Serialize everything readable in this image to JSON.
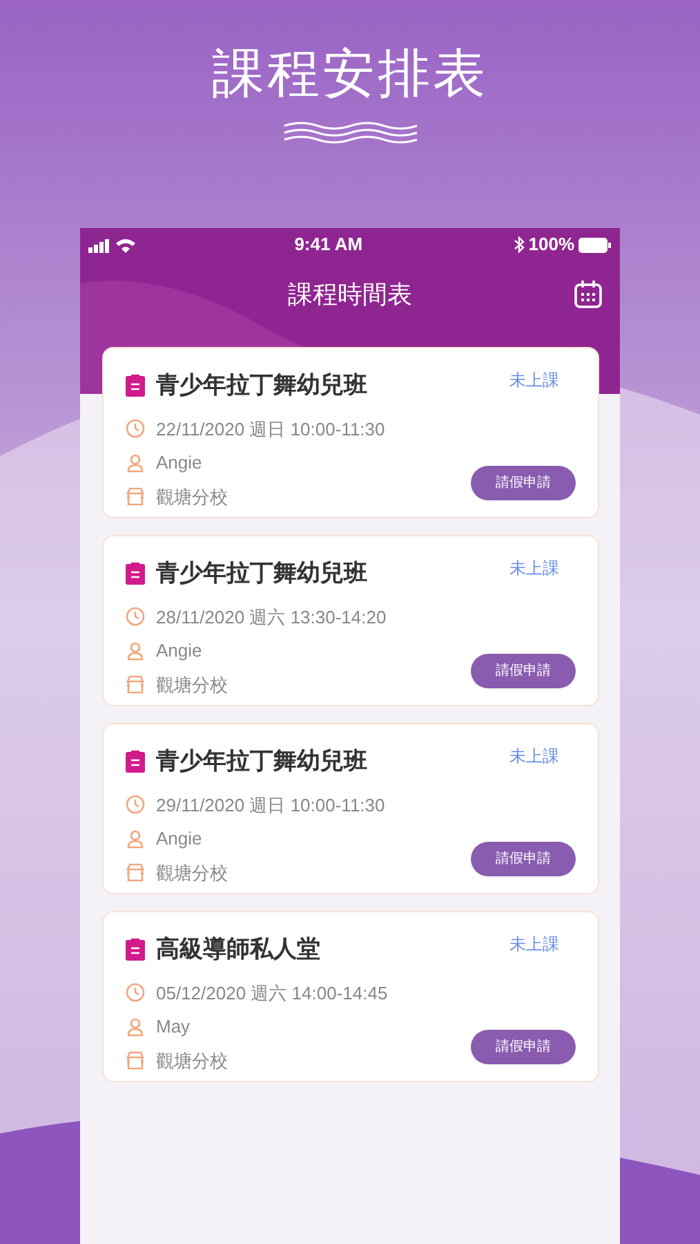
{
  "headline": "課程安排表",
  "status_bar": {
    "time": "9:41 AM",
    "battery": "100%"
  },
  "header": {
    "title": "課程時間表"
  },
  "lessons": [
    {
      "title": "青少年拉丁舞幼兒班",
      "status": "未上課",
      "datetime": "22/11/2020 週日 10:00-11:30",
      "teacher": "Angie",
      "branch": "觀塘分校",
      "action": "請假申請"
    },
    {
      "title": "青少年拉丁舞幼兒班",
      "status": "未上課",
      "datetime": "28/11/2020 週六 13:30-14:20",
      "teacher": "Angie",
      "branch": "觀塘分校",
      "action": "請假申請"
    },
    {
      "title": "青少年拉丁舞幼兒班",
      "status": "未上課",
      "datetime": "29/11/2020 週日 10:00-11:30",
      "teacher": "Angie",
      "branch": "觀塘分校",
      "action": "請假申請"
    },
    {
      "title": "高級導師私人堂",
      "status": "未上課",
      "datetime": "05/12/2020 週六 14:00-14:45",
      "teacher": "May",
      "branch": "觀塘分校",
      "action": "請假申請"
    }
  ]
}
